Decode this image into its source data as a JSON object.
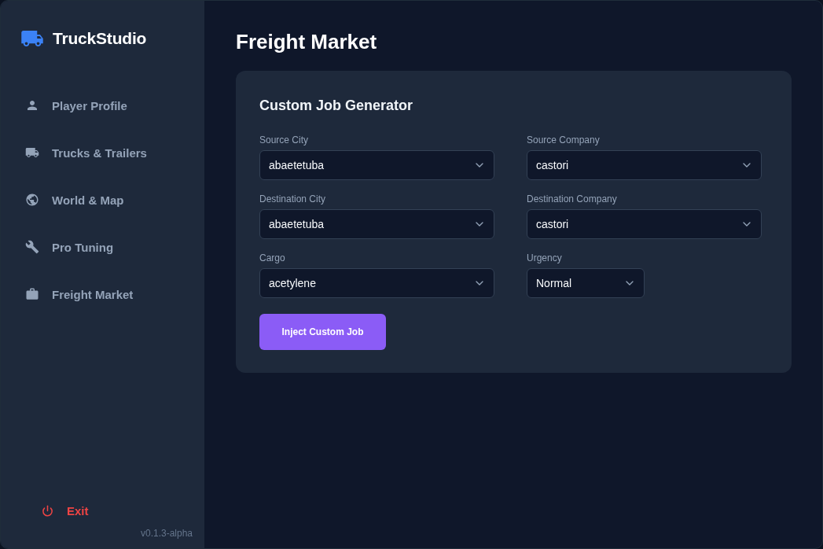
{
  "app": {
    "name": "TruckStudio"
  },
  "sidebar": {
    "items": [
      {
        "label": "Player Profile"
      },
      {
        "label": "Trucks & Trailers"
      },
      {
        "label": "World & Map"
      },
      {
        "label": "Pro Tuning"
      },
      {
        "label": "Freight Market"
      }
    ],
    "exit": {
      "label": "Exit"
    },
    "version": "v0.1.3-alpha"
  },
  "page": {
    "title": "Freight Market"
  },
  "card": {
    "title": "Custom Job Generator",
    "fields": [
      {
        "label": "Source City",
        "value": "abaetetuba",
        "kind": "wide"
      },
      {
        "label": "Source Company",
        "value": "castori",
        "kind": "wide"
      },
      {
        "label": "Destination City",
        "value": "abaetetuba",
        "kind": "wide"
      },
      {
        "label": "Destination Company",
        "value": "castori",
        "kind": "wide"
      },
      {
        "label": "Cargo",
        "value": "acetylene",
        "kind": "wide"
      },
      {
        "label": "Urgency",
        "value": "Normal",
        "kind": "compact"
      }
    ],
    "button": "Inject Custom Job"
  }
}
